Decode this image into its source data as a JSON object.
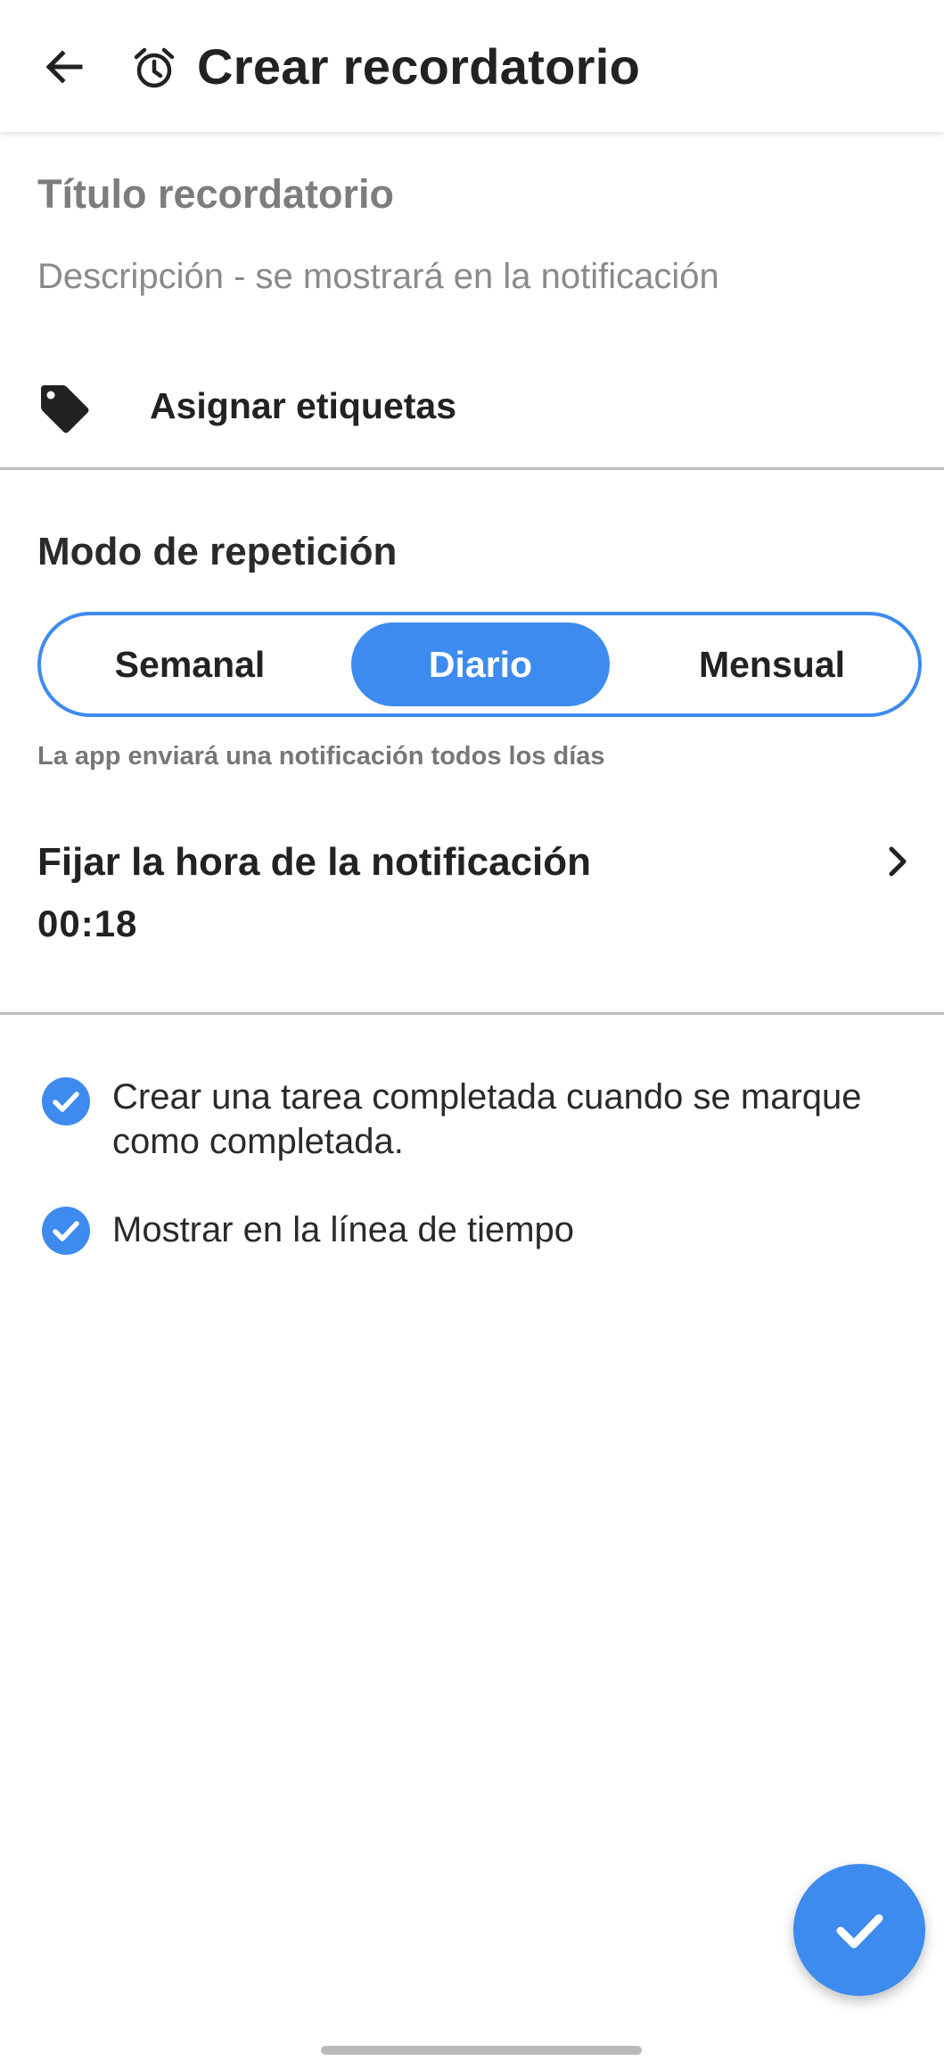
{
  "appbar": {
    "title": "Crear recordatorio",
    "back_icon": "arrow-left",
    "title_icon": "alarm-clock"
  },
  "form": {
    "title_placeholder": "Título recordatorio",
    "description_placeholder": "Descripción - se mostrará en la notificación",
    "tags_label": "Asignar etiquetas",
    "tags_icon": "tag"
  },
  "repeat": {
    "section_title": "Modo de repetición",
    "options": [
      "Semanal",
      "Diario",
      "Mensual"
    ],
    "selected": "Diario",
    "helper": "La app enviará una notificación todos los días"
  },
  "notification_time": {
    "label": "Fijar la hora de la notificación",
    "value": "00:18"
  },
  "options": [
    {
      "label": "Crear una tarea completada cuando se marque como completada.",
      "checked": true
    },
    {
      "label": "Mostrar en la línea de tiempo",
      "checked": true
    }
  ],
  "fab": {
    "icon": "checkmark"
  },
  "colors": {
    "accent": "#3d8bef",
    "divider": "#bdbdbd",
    "placeholder": "#7d7d7d"
  }
}
